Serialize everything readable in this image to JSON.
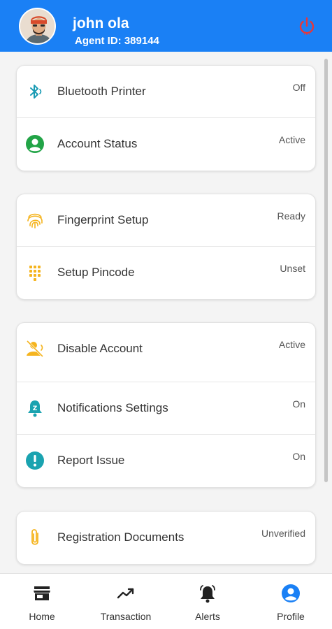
{
  "header": {
    "user_name": "john ola",
    "agent_id": "Agent ID: 389144",
    "bg_color": "#1a80f5",
    "power_icon": "power-icon"
  },
  "settings": {
    "group1": [
      {
        "label": "Bluetooth Printer",
        "value": "Off",
        "icon": "bluetooth-icon"
      },
      {
        "label": "Account Status",
        "value": "Active",
        "icon": "account-circle-icon"
      }
    ],
    "group2": [
      {
        "label": "Fingerprint Setup",
        "value": "Ready",
        "icon": "fingerprint-icon"
      },
      {
        "label": "Setup Pincode",
        "value": "Unset",
        "icon": "keypad-icon"
      }
    ],
    "group3": [
      {
        "label": "Disable Account",
        "value": "Active",
        "icon": "user-off-icon"
      },
      {
        "label": "Notifications Settings",
        "value": "On",
        "icon": "notification-bell-icon"
      },
      {
        "label": "Report Issue",
        "value": "On",
        "icon": "alert-circle-icon"
      }
    ],
    "group4": [
      {
        "label": "Registration Documents",
        "value": "Unverified",
        "icon": "paperclip-icon"
      }
    ]
  },
  "bottom_nav": [
    {
      "label": "Home",
      "icon": "store-icon",
      "active": false
    },
    {
      "label": "Transaction",
      "icon": "trending-up-icon",
      "active": false
    },
    {
      "label": "Alerts",
      "icon": "bell-icon",
      "active": false
    },
    {
      "label": "Profile",
      "icon": "profile-icon",
      "active": true
    }
  ],
  "colors": {
    "accent": "#1a80f5",
    "power": "#e5383b",
    "green": "#22a447",
    "yellow": "#f5b41e",
    "teal": "#1aa3b0"
  }
}
